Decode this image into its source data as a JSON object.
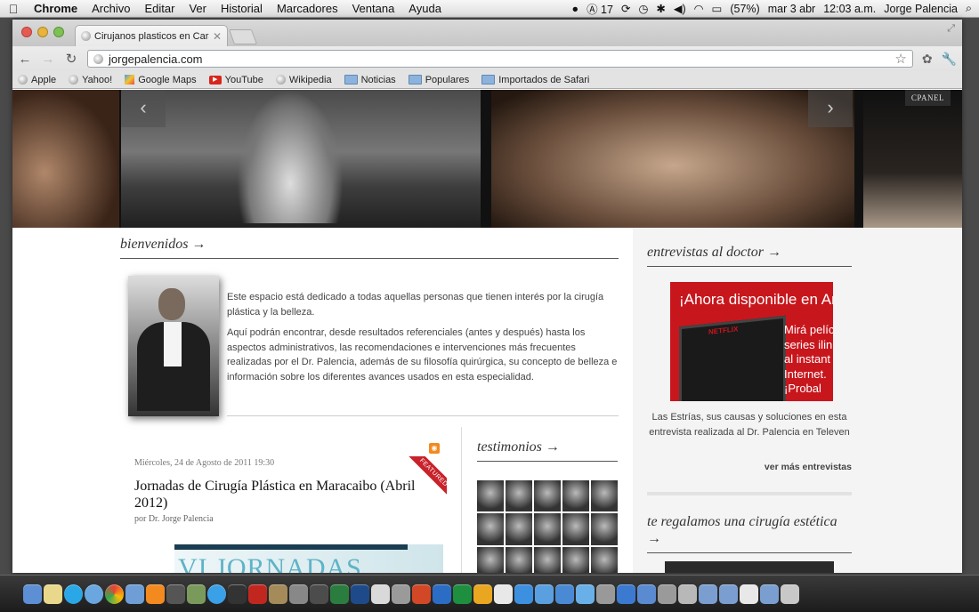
{
  "menubar": {
    "app": "Chrome",
    "menus": [
      "Archivo",
      "Editar",
      "Ver",
      "Historial",
      "Marcadores",
      "Ventana",
      "Ayuda"
    ],
    "badge_count": "17",
    "battery": "(57%)",
    "date": "mar 3 abr",
    "time": "12:03 a.m.",
    "user": "Jorge Palencia"
  },
  "browser": {
    "tab_title": "Cirujanos plasticos en Caracas",
    "url": "jorgepalencia.com",
    "bookmarks": [
      {
        "label": "Apple",
        "icon": "globe-icon"
      },
      {
        "label": "Yahoo!",
        "icon": "globe-icon"
      },
      {
        "label": "Google Maps",
        "icon": "google-maps-icon"
      },
      {
        "label": "YouTube",
        "icon": "youtube-icon"
      },
      {
        "label": "Wikipedia",
        "icon": "globe-icon"
      },
      {
        "label": "Noticias",
        "icon": "folder-icon"
      },
      {
        "label": "Populares",
        "icon": "folder-icon"
      },
      {
        "label": "Importados de Safari",
        "icon": "folder-icon"
      }
    ]
  },
  "page": {
    "cpanel_label": "CPANEL",
    "welcome": {
      "title": "bienvenidos →",
      "p1": "Este espacio está dedicado a todas aquellas personas que tienen interés por la cirugía plástica y la belleza.",
      "p2": "Aquí podrán encontrar, desde resultados referenciales (antes y después) hasta los aspectos administrativos, las recomendaciones e intervenciones más frecuentes realizadas por el Dr. Palencia, además de su filosofía quirúrgica, su concepto de belleza e información sobre los diferentes avances usados en esta especialidad."
    },
    "post": {
      "date": "Miércoles, 24 de Agosto de 2011 19:30",
      "title": "Jornadas de Cirugía Plástica en Maracaibo (Abril 2012)",
      "author": "por Dr. Jorge Palencia",
      "featured_label": "FEATURED",
      "image_text": "VI JORNADAS"
    },
    "testimonios": {
      "title": "testimonios →"
    },
    "sidebar": {
      "entrevistas_title": "entrevistas al doctor →",
      "ad_headline": "¡Ahora disponible en Ar",
      "ad_copy": "Mirá pelíc\nseries ilin\nal instant\nInternet.\n¡Probal",
      "ad_brand": "NETFLIX",
      "caption": "Las Estrías, sus causas y soluciones en esta entrevista realizada al Dr. Palencia en Televen",
      "more_link": "ver más entrevistas",
      "regalo_title": "te regalamos una cirugía estética →"
    }
  },
  "colors": {
    "accent_red": "#c8161d",
    "text": "#444444"
  }
}
